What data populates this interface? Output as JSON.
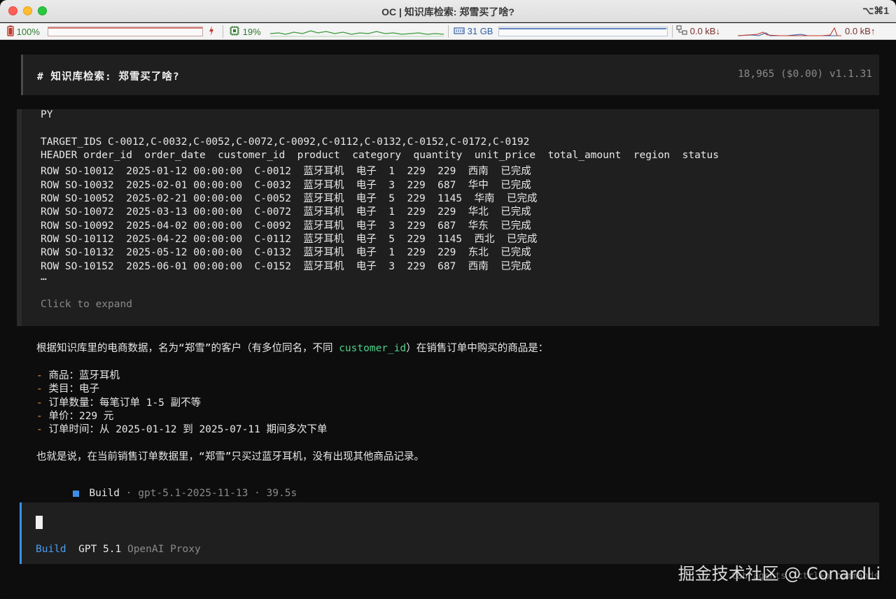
{
  "window": {
    "title": "OC | 知识库检索: 郑雪买了啥?",
    "shortcut": "⌥⌘1"
  },
  "statusbar": {
    "battery": "100%",
    "cpu": "19%",
    "memory": "31 GB",
    "net_down": "0.0 kB↓",
    "net_up": "0.0 kB↑"
  },
  "session": {
    "title": "# 知识库检索: 郑雪买了啥?",
    "meta": "18,965 ($0.00) v1.1.31"
  },
  "code": {
    "lang": "PY",
    "target_ids": "TARGET_IDS C-0012,C-0032,C-0052,C-0072,C-0092,C-0112,C-0132,C-0152,C-0172,C-0192",
    "header": "HEADER order_id  order_date  customer_id  product  category  quantity  unit_price  total_amount  region  status",
    "rows": [
      "ROW SO-10012  2025-01-12 00:00:00  C-0012  蓝牙耳机  电子  1  229  229  西南  已完成",
      "ROW SO-10032  2025-02-01 00:00:00  C-0032  蓝牙耳机  电子  3  229  687  华中  已完成",
      "ROW SO-10052  2025-02-21 00:00:00  C-0052  蓝牙耳机  电子  5  229  1145  华南  已完成",
      "ROW SO-10072  2025-03-13 00:00:00  C-0072  蓝牙耳机  电子  1  229  229  华北  已完成",
      "ROW SO-10092  2025-04-02 00:00:00  C-0092  蓝牙耳机  电子  3  229  687  华东  已完成",
      "ROW SO-10112  2025-04-22 00:00:00  C-0112  蓝牙耳机  电子  5  229  1145  西北  已完成",
      "ROW SO-10132  2025-05-12 00:00:00  C-0132  蓝牙耳机  电子  1  229  229  东北  已完成",
      "ROW SO-10152  2025-06-01 00:00:00  C-0152  蓝牙耳机  电子  3  229  687  西南  已完成"
    ],
    "ellipsis": "…",
    "expand": "Click to expand"
  },
  "answer": {
    "intro_pre": "根据知识库里的电商数据，名为“郑雪”的客户（有多位同名，不同 ",
    "intro_code": "customer_id",
    "intro_post": "）在销售订单中购买的商品是：",
    "bullets": [
      "商品：蓝牙耳机",
      "类目：电子",
      "订单数量：每笔订单 1-5 副不等",
      "单价：229 元",
      "订单时间：从 2025-01-12 到 2025-07-11 期间多次下单"
    ],
    "bullet_marker": "-",
    "summary": "也就是说，在当前销售订单数据里，“郑雪”只买过蓝牙耳机，没有出现其他商品记录。"
  },
  "build": {
    "name": "Build",
    "meta": " · gpt-5.1-2025-11-13 · 39.5s"
  },
  "input": {
    "mode": "Build",
    "model": "GPT 5.1",
    "provider": "OpenAI Proxy"
  },
  "footer": {
    "hint": "tab agents  ctrl+p commands",
    "watermark": "掘金技术社区 @ ConardLi"
  },
  "colors": {
    "accent": "#3d8ee8",
    "highlight": "#4fd18b",
    "bullet": "#f0913a",
    "statusbar_text": "#2f7a2f"
  }
}
